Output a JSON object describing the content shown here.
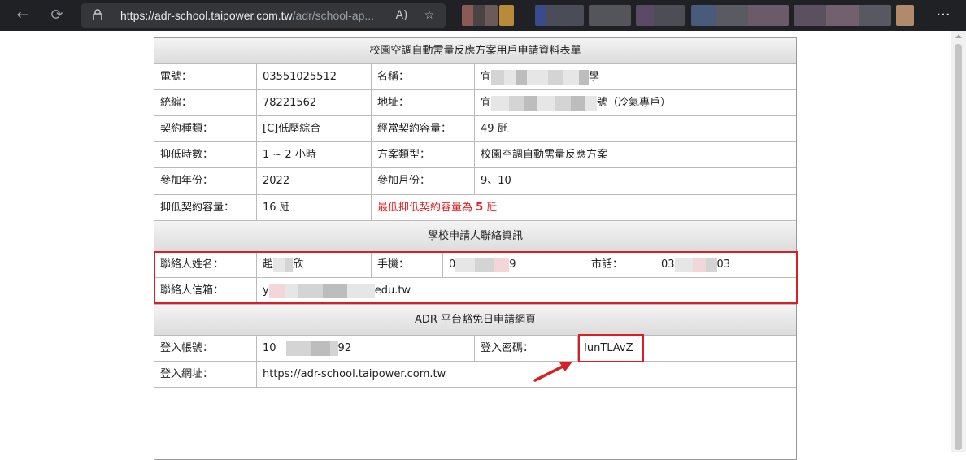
{
  "browser": {
    "url_host": "https://adr-school.taipower.com.tw",
    "url_path": "/adr/school-ap...",
    "icons": [
      "back-icon",
      "refresh-icon",
      "lock-icon",
      "read-aloud-icon",
      "favorite-add-icon",
      "more-icon"
    ],
    "back_glyph": "←",
    "refresh_glyph": "⟳",
    "lock_glyph": "🔒",
    "read_aloud_glyph": "A)",
    "favorite_glyph": "☆",
    "more_glyph": "···"
  },
  "section1": {
    "title": "校園空調自動需量反應方案用戶申請資料表單",
    "rows": [
      {
        "l1": "電號：",
        "v1": "03551025512",
        "l2": "名稱：",
        "v2_prefix": "宜",
        "v2_suffix": "學"
      },
      {
        "l1": "統編：",
        "v1": "78221562",
        "l2": "地址：",
        "v2_prefix": "宜",
        "v2_suffix": "號（冷氣專戶）"
      },
      {
        "l1": "契約種類：",
        "v1": "[C]低壓綜合",
        "l2": "經常契約容量：",
        "v2": "49 瓩"
      },
      {
        "l1": "抑低時數：",
        "v1": "1 ~ 2 小時",
        "l2": "方案類型：",
        "v2": "校園空調自動需量反應方案"
      },
      {
        "l1": "參加年份：",
        "v1": "2022",
        "l2": "參加月份：",
        "v2": "9、10"
      },
      {
        "l1": "抑低契約容量：",
        "v1": "16 瓩",
        "warn_text": "最低抑低契約容量為",
        "warn_num": "5",
        "warn_unit": "瓩"
      }
    ]
  },
  "section2": {
    "title": "學校申請人聯絡資訊",
    "contact_name_label": "聯絡人姓名：",
    "contact_name_prefix": "趙",
    "contact_name_suffix": "欣",
    "mobile_label": "手機：",
    "mobile_prefix": "0",
    "mobile_suffix": "9",
    "phone_label": "市話：",
    "phone_prefix": "03",
    "phone_suffix": "03",
    "email_label": "聯絡人信箱：",
    "email_prefix": "y",
    "email_suffix": "edu.tw"
  },
  "section3": {
    "title": "ADR 平台豁免日申請網頁",
    "account_label": "登入帳號：",
    "account_prefix": "10",
    "account_suffix": "92",
    "password_label": "登入密碼：",
    "password_value": "IunTLAvZ",
    "url_label": "登入網址：",
    "url_value": "https://adr-school.taipower.com.tw"
  },
  "colors": {
    "highlight": "#d81f26",
    "warning": "#e02020",
    "chrome": "#202124"
  }
}
